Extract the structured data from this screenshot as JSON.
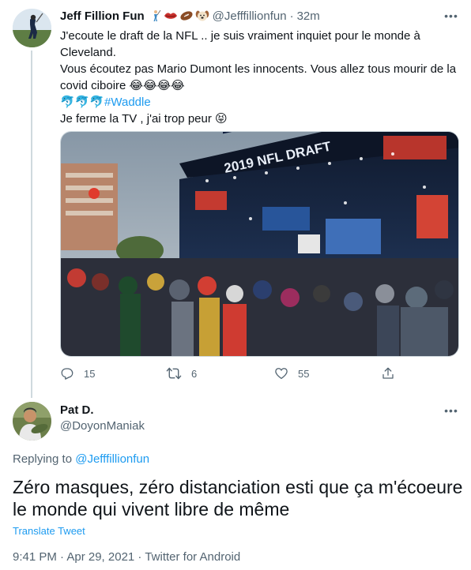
{
  "tweet1": {
    "author_name": "Jeff Fillion Fun",
    "name_emojis": [
      "golfer-emoji",
      "lips-emoji",
      "football-emoji",
      "dog-face-emoji"
    ],
    "handle": "@Jefffillionfun",
    "separator": "·",
    "time": "32m",
    "lines": {
      "line1": "J'ecoute le draft de la NFL .. je suis vraiment inquiet pour le monde à Cleveland.",
      "line2_text": "Vous écoutez pas Mario Dumont les innocents. Vous allez tous mourir de la covid ciboire",
      "line2_emojis": "😂😂😂😂",
      "line3_emojis": "🐬🐬🐬",
      "line3_hashtag": "#Waddle",
      "line4_text": "Je ferme la TV , j'ai trop peur",
      "line4_emoji": "😝"
    },
    "image_stage_text": "2019 NFL DRAFT",
    "stats": {
      "replies": "15",
      "retweets": "6",
      "likes": "55"
    }
  },
  "tweet2": {
    "author_name": "Pat D.",
    "handle": "@DoyonManiak",
    "replying_prefix": "Replying to",
    "replying_to": "@Jefffillionfun",
    "text": "Zéro masques, zéro distanciation esti que ça m'écoeure le monde qui vivent libre de même",
    "translate_label": "Translate Tweet",
    "timestamp": "9:41 PM · Apr 29, 2021 · Twitter for Android"
  },
  "colors": {
    "link_blue": "#1d9bf0",
    "secondary_text": "#536471",
    "primary_text": "#0f1419",
    "thread_line": "#cfd9de"
  }
}
